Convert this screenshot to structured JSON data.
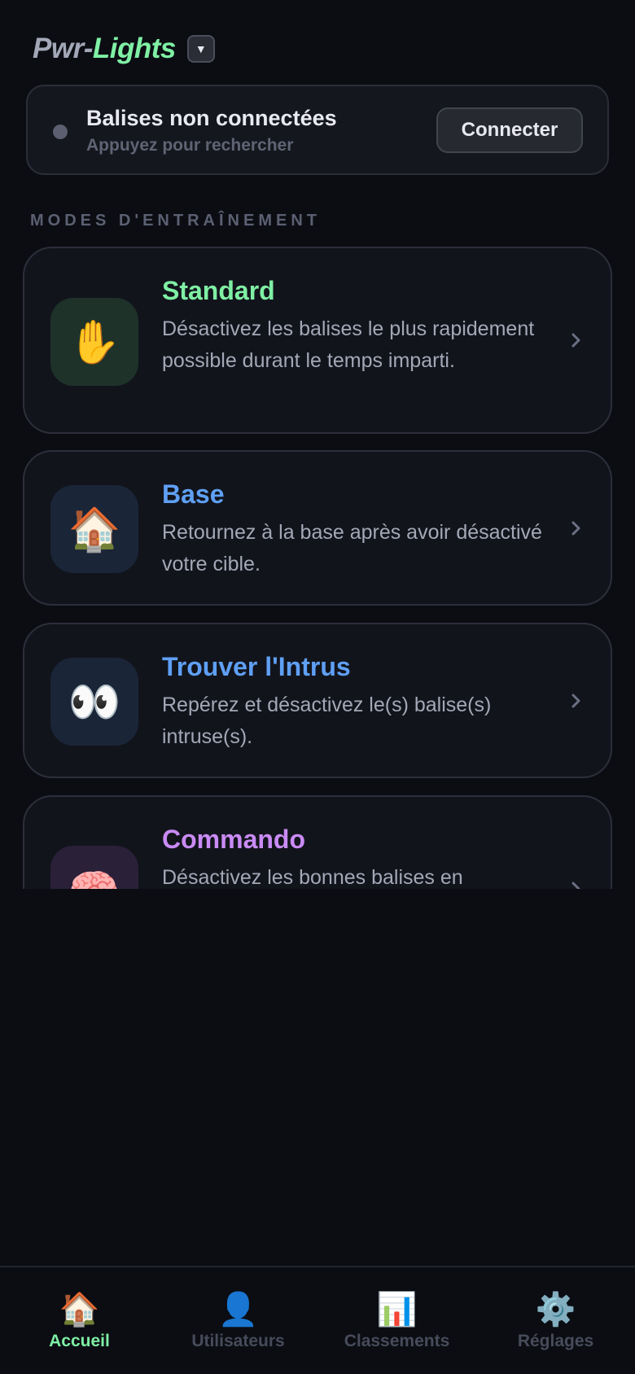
{
  "header": {
    "logo_part1": "Pwr-",
    "logo_part2": "Lights",
    "menu_icon": "▼"
  },
  "connection": {
    "title": "Balises non connectées",
    "subtitle": "Appuyez pour rechercher",
    "button_label": "Connecter",
    "status_color": "#5b5f70"
  },
  "section_title": "MODES D'ENTRAÎNEMENT",
  "modes": [
    {
      "title": "Standard",
      "description": "Désactivez les balises le plus rapidement possible durant le temps imparti.",
      "icon": "✋",
      "icon_name": "raised-hand-icon",
      "color": "#7ff0a4",
      "icon_bg": "#1e3229"
    },
    {
      "title": "Base",
      "description": "Retournez à la base après avoir désactivé votre cible.",
      "icon": "🏠",
      "icon_name": "house-icon",
      "color": "#5fa0f5",
      "icon_bg": "#1a2538"
    },
    {
      "title": "Trouver l'Intrus",
      "description": "Repérez et désactivez le(s) balise(s) intruse(s).",
      "icon": "👀",
      "icon_name": "eyes-icon",
      "color": "#5fa0f5",
      "icon_bg": "#1a2538"
    },
    {
      "title": "Commando",
      "description": "Désactivez les bonnes balises en",
      "icon": "🧠",
      "icon_name": "brain-icon",
      "color": "#c98bf5",
      "icon_bg": "#2a2038"
    }
  ],
  "tabs": [
    {
      "label": "Accueil",
      "icon": "🏠",
      "icon_name": "home-icon",
      "active": true
    },
    {
      "label": "Utilisateurs",
      "icon": "👤",
      "icon_name": "user-icon",
      "active": false
    },
    {
      "label": "Classements",
      "icon": "📊",
      "icon_name": "bar-chart-icon",
      "active": false
    },
    {
      "label": "Réglages",
      "icon": "⚙️",
      "icon_name": "gear-icon",
      "active": false
    }
  ],
  "colors": {
    "background": "#0b0d13",
    "accent_green": "#7ff0a4",
    "accent_blue": "#5fa0f5",
    "accent_purple": "#c98bf5"
  }
}
